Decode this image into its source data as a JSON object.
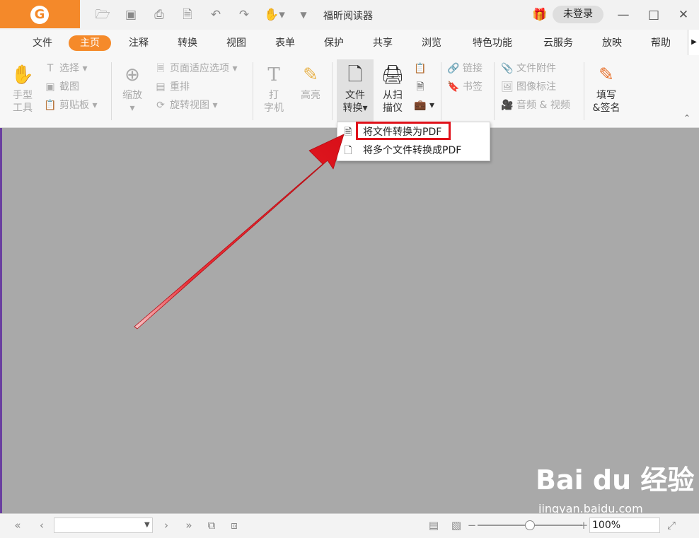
{
  "titlebar": {
    "logo_glyph": "G",
    "app_title": "福昕阅读器",
    "login_label": "未登录",
    "icons": [
      "folder-open-icon",
      "save-icon",
      "print-icon",
      "new-file-icon",
      "undo-icon",
      "redo-icon",
      "hand-icon",
      "customize-icon"
    ],
    "window_buttons": [
      "minimize-icon",
      "maximize-icon",
      "close-icon"
    ]
  },
  "menu": {
    "tabs": [
      "文件",
      "主页",
      "注释",
      "转换",
      "视图",
      "表单",
      "保护",
      "共享",
      "浏览",
      "特色功能",
      "云服务",
      "放映",
      "帮助"
    ],
    "active": "主页"
  },
  "ribbon": {
    "hand_tool": {
      "line1": "手型",
      "line2": "工具"
    },
    "select": "选择",
    "screenshot": "截图",
    "clipboard": "剪贴板",
    "zoom": "缩放",
    "page_fit": "页面适应选项",
    "reflow": "重排",
    "rotate_view": "旋转视图",
    "typewriter": {
      "line1": "打",
      "line2": "字机"
    },
    "highlight": "高亮",
    "file_convert": {
      "line1": "文件",
      "line2": "转换"
    },
    "from_scanner": {
      "line1": "从扫",
      "line2": "描仪"
    },
    "link": "链接",
    "bookmark": "书签",
    "file_attachment": "文件附件",
    "image_annotation": "图像标注",
    "audio_video": "音频 & 视频",
    "fill_sign": {
      "line1": "填写",
      "line2": "&签名"
    }
  },
  "dropdown": {
    "items": [
      "将文件转换为PDF",
      "将多个文件转换成PDF"
    ]
  },
  "watermark": {
    "main": "Bai du 经验",
    "url": "jingyan.baidu.com"
  },
  "statusbar": {
    "page_value": "",
    "zoom_value": "100%"
  },
  "colors": {
    "accent": "#f58a2a",
    "highlight_box": "#e0111a",
    "arrow": "#e8141c"
  }
}
